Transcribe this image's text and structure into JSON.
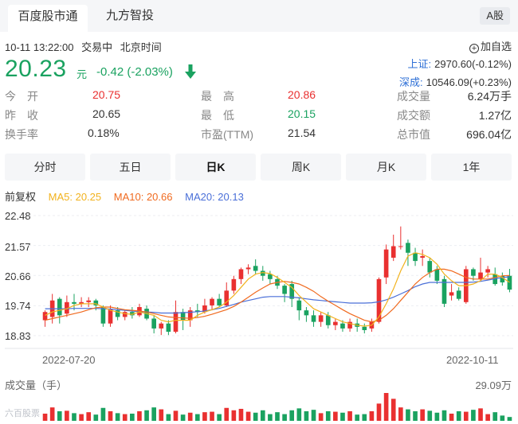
{
  "tabs": [
    {
      "label": "百度股市通",
      "active": true
    },
    {
      "label": "九方智投",
      "active": false
    }
  ],
  "market_badge": "A股",
  "status": {
    "datetime": "10-11 13:22:00",
    "state": "交易中",
    "timezone": "北京时间"
  },
  "watchlist_label": "加自选",
  "quote": {
    "price": "20.23",
    "unit": "元",
    "change": "-0.42 (-2.03%)"
  },
  "indices": [
    {
      "name": "上证:",
      "value": "2970.60(-0.12%)"
    },
    {
      "name": "深成:",
      "value": "10546.09(+0.23%)"
    }
  ],
  "stats": {
    "open_label": "今　开",
    "open": "20.75",
    "prev_label": "昨　收",
    "prev": "20.65",
    "turnover_label": "换手率",
    "turnover": "0.18%",
    "high_label": "最　高",
    "high": "20.86",
    "low_label": "最　低",
    "low": "20.15",
    "pe_label": "市盈(TTM)",
    "pe": "21.54",
    "volume_label": "成交量",
    "volume": "6.24万手",
    "amount_label": "成交额",
    "amount": "1.27亿",
    "mcap_label": "总市值",
    "mcap": "696.04亿"
  },
  "periods": [
    {
      "label": "分时",
      "active": false
    },
    {
      "label": "五日",
      "active": false
    },
    {
      "label": "日K",
      "active": true
    },
    {
      "label": "周K",
      "active": false
    },
    {
      "label": "月K",
      "active": false
    },
    {
      "label": "1年",
      "active": false
    }
  ],
  "legend": {
    "adjust": "前复权",
    "ma5": "MA5: 20.25",
    "ma10": "MA10: 20.66",
    "ma20": "MA20: 20.13"
  },
  "colors": {
    "up": "#e93030",
    "down": "#1aa260",
    "ma5": "#f2b21d",
    "ma10": "#f06a1f",
    "ma20": "#4a6fd8",
    "link": "#2d6fd6"
  },
  "volume": {
    "label": "成交量（手）",
    "max_label": "29.09万"
  },
  "watermark": "六百股票",
  "chart_data": {
    "type": "candlestick",
    "y_ticks": [
      "22.48",
      "21.57",
      "20.66",
      "19.74",
      "18.83"
    ],
    "ylim": [
      18.83,
      22.48
    ],
    "x_ticks": [
      "2022-07-20",
      "2022-10-11"
    ],
    "candles": [
      [
        19.3,
        19.55,
        19.6,
        19.1
      ],
      [
        19.4,
        19.9,
        20.1,
        19.2
      ],
      [
        19.95,
        19.45,
        20.0,
        19.2
      ],
      [
        19.5,
        19.85,
        20.05,
        19.4
      ],
      [
        19.85,
        19.8,
        20.1,
        19.6
      ],
      [
        19.8,
        19.85,
        20.0,
        19.7
      ],
      [
        19.85,
        19.9,
        20.0,
        19.7
      ],
      [
        19.9,
        19.75,
        19.95,
        19.6
      ],
      [
        19.7,
        19.2,
        19.75,
        19.1
      ],
      [
        19.2,
        19.65,
        19.75,
        19.1
      ],
      [
        19.6,
        19.4,
        19.7,
        19.3
      ],
      [
        19.4,
        19.55,
        19.6,
        19.3
      ],
      [
        19.55,
        19.45,
        19.7,
        19.35
      ],
      [
        19.45,
        19.7,
        19.8,
        19.4
      ],
      [
        19.65,
        19.35,
        19.75,
        19.3
      ],
      [
        19.35,
        19.05,
        19.45,
        18.9
      ],
      [
        19.05,
        19.2,
        19.25,
        18.85
      ],
      [
        19.2,
        18.95,
        19.3,
        18.85
      ],
      [
        18.95,
        19.55,
        19.9,
        18.9
      ],
      [
        19.55,
        19.3,
        19.65,
        19.0
      ],
      [
        19.3,
        19.6,
        19.7,
        19.1
      ],
      [
        19.6,
        19.55,
        19.8,
        19.4
      ],
      [
        19.55,
        19.75,
        19.95,
        19.5
      ],
      [
        19.75,
        19.95,
        20.0,
        19.6
      ],
      [
        19.95,
        19.75,
        20.1,
        19.7
      ],
      [
        19.75,
        20.2,
        20.45,
        19.7
      ],
      [
        20.2,
        20.55,
        20.65,
        20.1
      ],
      [
        20.55,
        20.85,
        20.9,
        20.4
      ],
      [
        20.85,
        20.9,
        21.0,
        20.7
      ],
      [
        20.95,
        20.8,
        21.15,
        20.7
      ],
      [
        20.8,
        20.65,
        20.95,
        20.5
      ],
      [
        20.7,
        20.55,
        20.8,
        20.4
      ],
      [
        20.55,
        20.35,
        20.65,
        20.25
      ],
      [
        20.35,
        20.1,
        20.4,
        19.85
      ],
      [
        20.4,
        19.95,
        20.5,
        19.7
      ],
      [
        19.9,
        19.6,
        20.0,
        19.3
      ],
      [
        19.6,
        19.45,
        19.7,
        19.25
      ],
      [
        19.45,
        19.25,
        19.6,
        19.1
      ],
      [
        19.25,
        19.45,
        19.55,
        19.1
      ],
      [
        19.45,
        19.15,
        19.55,
        19.05
      ],
      [
        19.15,
        19.25,
        19.35,
        19.0
      ],
      [
        19.2,
        19.05,
        19.3,
        18.95
      ],
      [
        19.05,
        19.25,
        19.35,
        18.95
      ],
      [
        19.2,
        19.1,
        19.35,
        18.95
      ],
      [
        19.1,
        19.0,
        19.2,
        18.9
      ],
      [
        19.05,
        19.25,
        19.35,
        18.95
      ],
      [
        19.25,
        20.55,
        20.6,
        19.2
      ],
      [
        20.6,
        21.45,
        21.6,
        20.4
      ],
      [
        21.2,
        21.55,
        21.9,
        21.1
      ],
      [
        21.55,
        21.55,
        22.15,
        21.45
      ],
      [
        21.65,
        21.35,
        21.75,
        20.95
      ],
      [
        21.35,
        21.1,
        21.5,
        20.95
      ],
      [
        21.2,
        21.25,
        21.45,
        20.95
      ],
      [
        21.1,
        20.75,
        21.2,
        20.6
      ],
      [
        20.85,
        20.5,
        20.95,
        20.4
      ],
      [
        20.55,
        19.8,
        20.65,
        19.7
      ],
      [
        20.05,
        20.15,
        20.4,
        19.9
      ],
      [
        20.2,
        19.95,
        20.3,
        19.9
      ],
      [
        19.85,
        20.85,
        20.95,
        19.8
      ],
      [
        20.85,
        20.65,
        20.9,
        20.5
      ],
      [
        20.55,
        20.75,
        21.2,
        20.5
      ],
      [
        20.75,
        20.85,
        20.95,
        20.6
      ],
      [
        20.7,
        20.4,
        20.9,
        20.35
      ],
      [
        20.65,
        20.45,
        20.75,
        20.35
      ],
      [
        20.65,
        20.23,
        20.86,
        20.15
      ]
    ],
    "ma5": [
      19.45,
      19.55,
      19.6,
      19.65,
      19.75,
      19.8,
      19.8,
      19.8,
      19.7,
      19.6,
      19.55,
      19.5,
      19.48,
      19.55,
      19.5,
      19.45,
      19.3,
      19.25,
      19.3,
      19.3,
      19.3,
      19.45,
      19.55,
      19.62,
      19.7,
      19.85,
      20.05,
      20.3,
      20.55,
      20.7,
      20.75,
      20.72,
      20.6,
      20.45,
      20.3,
      20.05,
      19.85,
      19.65,
      19.55,
      19.45,
      19.35,
      19.25,
      19.2,
      19.15,
      19.12,
      19.15,
      19.4,
      19.8,
      20.25,
      20.8,
      21.25,
      21.35,
      21.3,
      21.2,
      21.0,
      20.7,
      20.5,
      20.35,
      20.35,
      20.4,
      20.5,
      20.7,
      20.7,
      20.6,
      20.45
    ],
    "ma10": [
      19.3,
      19.35,
      19.4,
      19.45,
      19.5,
      19.55,
      19.62,
      19.68,
      19.7,
      19.7,
      19.66,
      19.62,
      19.6,
      19.58,
      19.55,
      19.5,
      19.45,
      19.4,
      19.38,
      19.37,
      19.36,
      19.38,
      19.42,
      19.48,
      19.55,
      19.62,
      19.72,
      19.85,
      20.0,
      20.15,
      20.28,
      20.4,
      20.45,
      20.48,
      20.45,
      20.4,
      20.3,
      20.18,
      20.02,
      19.88,
      19.75,
      19.62,
      19.5,
      19.4,
      19.3,
      19.25,
      19.3,
      19.45,
      19.65,
      19.9,
      20.15,
      20.4,
      20.6,
      20.75,
      20.85,
      20.85,
      20.8,
      20.7,
      20.6,
      20.55,
      20.55,
      20.55,
      20.6,
      20.65,
      20.66
    ],
    "ma20": [
      19.65,
      19.65,
      19.65,
      19.65,
      19.66,
      19.66,
      19.66,
      19.66,
      19.65,
      19.64,
      19.62,
      19.6,
      19.58,
      19.56,
      19.55,
      19.54,
      19.52,
      19.52,
      19.52,
      19.53,
      19.54,
      19.56,
      19.58,
      19.62,
      19.66,
      19.72,
      19.78,
      19.85,
      19.9,
      19.95,
      20.0,
      20.02,
      20.02,
      20.02,
      20.0,
      19.98,
      19.95,
      19.92,
      19.9,
      19.88,
      19.86,
      19.84,
      19.82,
      19.82,
      19.82,
      19.83,
      19.86,
      19.92,
      20.0,
      20.1,
      20.2,
      20.32,
      20.4,
      20.45,
      20.45,
      20.45,
      20.45,
      20.45,
      20.45,
      20.46,
      20.48,
      20.52,
      20.56,
      20.6,
      20.62
    ],
    "volumes": [
      7.5,
      14.0,
      10.0,
      10.5,
      8.0,
      7.0,
      9.0,
      6.5,
      13.5,
      10.0,
      8.0,
      7.0,
      7.5,
      10.0,
      11.0,
      14.0,
      12.0,
      7.0,
      10.5,
      6.5,
      8.5,
      7.0,
      9.0,
      9.5,
      7.0,
      13.5,
      11.0,
      12.5,
      9.5,
      8.5,
      11.0,
      7.0,
      9.0,
      7.0,
      11.0,
      13.0,
      10.0,
      11.5,
      8.0,
      10.0,
      9.5,
      8.5,
      10.0,
      6.5,
      7.0,
      10.0,
      18.0,
      29.09,
      23.0,
      14.0,
      12.0,
      10.0,
      12.0,
      10.5,
      8.5,
      11.0,
      7.5,
      10.0,
      9.5,
      11.5,
      13.0,
      7.0,
      9.0,
      5.5,
      4.0
    ]
  }
}
